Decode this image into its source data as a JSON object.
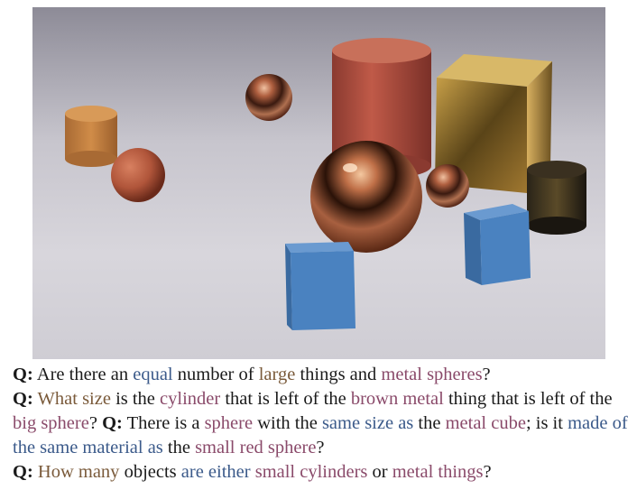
{
  "figure": {
    "scene_alt": "3D rendered scene",
    "objects": [
      {
        "name": "small-brown-cylinder",
        "color": "#c48040"
      },
      {
        "name": "small-red-sphere",
        "color": "#b55a3a"
      },
      {
        "name": "small-metal-sphere",
        "color": "#8a4a30"
      },
      {
        "name": "large-red-cylinder",
        "color": "#b55a48"
      },
      {
        "name": "large-gold-metal-cube",
        "color": "#a08030"
      },
      {
        "name": "large-metal-sphere",
        "color": "#9a5030"
      },
      {
        "name": "small-metal-sphere-right",
        "color": "#7a3a28"
      },
      {
        "name": "small-dark-metal-cylinder",
        "color": "#3a3020"
      },
      {
        "name": "blue-cube-front",
        "color": "#4a82c0"
      },
      {
        "name": "blue-cube-right",
        "color": "#4a82c0"
      }
    ]
  },
  "questions": [
    {
      "label": "Q:",
      "parts": [
        {
          "t": "Are there an ",
          "c": ""
        },
        {
          "t": "equal",
          "c": "hl-blue"
        },
        {
          "t": " number of ",
          "c": ""
        },
        {
          "t": "large",
          "c": "hl-olive"
        },
        {
          "t": " things and ",
          "c": ""
        },
        {
          "t": "metal spheres",
          "c": "hl-purple"
        },
        {
          "t": "?",
          "c": ""
        }
      ]
    },
    {
      "label": "Q:",
      "parts": [
        {
          "t": "What size",
          "c": "hl-olive"
        },
        {
          "t": " is the ",
          "c": ""
        },
        {
          "t": "cylinder",
          "c": "hl-purple"
        },
        {
          "t": " that is left of the ",
          "c": ""
        },
        {
          "t": "brown metal",
          "c": "hl-purple"
        },
        {
          "t": " thing that is left of the ",
          "c": ""
        },
        {
          "t": "big sphere",
          "c": "hl-purple"
        },
        {
          "t": "? ",
          "c": ""
        }
      ]
    },
    {
      "label": "Q:",
      "parts": [
        {
          "t": "There is a ",
          "c": ""
        },
        {
          "t": "sphere",
          "c": "hl-purple"
        },
        {
          "t": " with the ",
          "c": ""
        },
        {
          "t": "same size as",
          "c": "hl-blue"
        },
        {
          "t": " the ",
          "c": ""
        },
        {
          "t": "metal cube",
          "c": "hl-purple"
        },
        {
          "t": "; is it ",
          "c": ""
        },
        {
          "t": "made of the same material as",
          "c": "hl-blue"
        },
        {
          "t": " the ",
          "c": ""
        },
        {
          "t": "small red sphere",
          "c": "hl-purple"
        },
        {
          "t": "?",
          "c": ""
        }
      ]
    },
    {
      "label": "Q:",
      "parts": [
        {
          "t": "How many",
          "c": "hl-olive"
        },
        {
          "t": " objects ",
          "c": ""
        },
        {
          "t": "are either",
          "c": "hl-blue"
        },
        {
          "t": " ",
          "c": ""
        },
        {
          "t": "small cylinders",
          "c": "hl-purple"
        },
        {
          "t": " or ",
          "c": ""
        },
        {
          "t": "metal things",
          "c": "hl-purple"
        },
        {
          "t": "?",
          "c": ""
        }
      ]
    }
  ]
}
